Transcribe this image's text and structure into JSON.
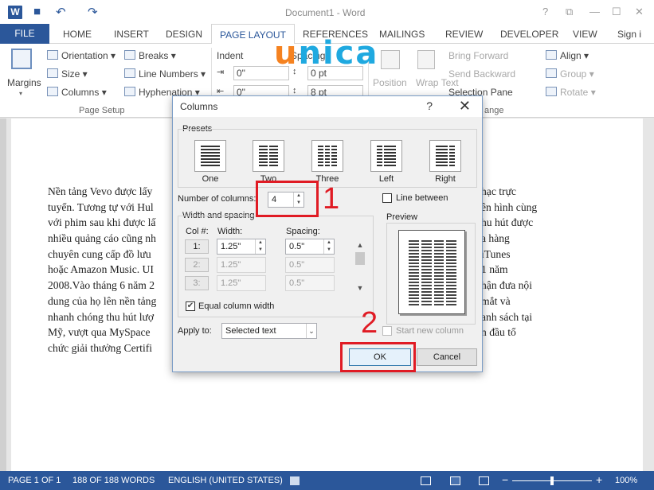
{
  "window": {
    "title": "Document1 - Word",
    "help": "?",
    "restore": "⧉",
    "minimize": "—",
    "maximize": "☐",
    "close": "✕"
  },
  "quick_access": {
    "save": "💾",
    "undo": "↶",
    "redo": "↷"
  },
  "tabs": [
    "FILE",
    "HOME",
    "INSERT",
    "DESIGN",
    "PAGE LAYOUT",
    "REFERENCES",
    "MAILINGS",
    "REVIEW",
    "DEVELOPER",
    "VIEW",
    "Sign i"
  ],
  "active_tab": "PAGE LAYOUT",
  "logo": {
    "first": "u",
    "rest": "nica"
  },
  "ribbon": {
    "margins": "Margins",
    "orientation": "Orientation",
    "size": "Size",
    "columns": "Columns",
    "breaks": "Breaks",
    "line_numbers": "Line Numbers",
    "hyphenation": "Hyphenation",
    "page_setup_group": "Page Setup",
    "indent": "Indent",
    "spacing": "Spacing",
    "indent_left": "0\"",
    "indent_right": "0\"",
    "spacing_before": "0 pt",
    "spacing_after": "8 pt",
    "position": "Position",
    "wrap_text": "Wrap Text",
    "bring_forward": "Bring Forward",
    "send_backward": "Send Backward",
    "selection_pane": "Selection Pane",
    "align": "Align",
    "group": "Group",
    "rotate": "Rotate",
    "arrange_group": "ange"
  },
  "document_lines": [
    "Nền tảng Vevo được lấy",
    "tuyển. Tương tự với Hul",
    "với phim sau khi được lấ",
    "nhiều quảng cáo cũng nh",
    "chuyên cung cấp đồ lưu",
    "hoặc Amazon Music. UI",
    "2008.Vào tháng 6 năm 2",
    "dung của họ lên nền tảng",
    "nhanh chóng thu hút lượ",
    "Mỹ, vượt qua MySpace",
    "chức giải thưởng Certifi"
  ],
  "document_lines_right": [
    "hạc trực",
    "ên hình cùng",
    "hu hút được",
    "a hàng",
    "iTunes",
    "1 năm",
    "hận đưa nội",
    "mắt và",
    "anh sách tại",
    "n đầu tổ",
    ""
  ],
  "dialog": {
    "title": "Columns",
    "help": "?",
    "close": "✕",
    "presets_label": "Presets",
    "presets": [
      {
        "label": "One",
        "cols": 1
      },
      {
        "label": "Two",
        "cols": 2
      },
      {
        "label": "Three",
        "cols": 3
      },
      {
        "label": "Left",
        "cols": 2
      },
      {
        "label": "Right",
        "cols": 2
      }
    ],
    "number_of_columns_label": "Number of columns:",
    "number_of_columns": "4",
    "line_between_label": "Line between",
    "width_spacing_label": "Width and spacing",
    "col_header": "Col #:",
    "width_header": "Width:",
    "spacing_header": "Spacing:",
    "rows": [
      {
        "col": "1:",
        "width": "1.25\"",
        "spacing": "0.5\""
      },
      {
        "col": "2:",
        "width": "1.25\"",
        "spacing": "0.5\""
      },
      {
        "col": "3:",
        "width": "1.25\"",
        "spacing": "0.5\""
      }
    ],
    "equal_width_label": "Equal column width",
    "equal_width_checked": "✔",
    "preview_label": "Preview",
    "apply_to_label": "Apply to:",
    "apply_to_value": "Selected text",
    "start_new_column_label": "Start new column",
    "ok_label": "OK",
    "cancel_label": "Cancel"
  },
  "annotations": {
    "step1": "1",
    "step2": "2",
    "color": "#e01b24"
  },
  "status": {
    "page": "PAGE 1 OF 1",
    "words": "188 OF 188 WORDS",
    "language": "ENGLISH (UNITED STATES)",
    "zoom": "100%"
  },
  "colors": {
    "accent": "#2b579a",
    "logo_orange": "#f58220",
    "logo_blue": "#1fa9e0"
  }
}
